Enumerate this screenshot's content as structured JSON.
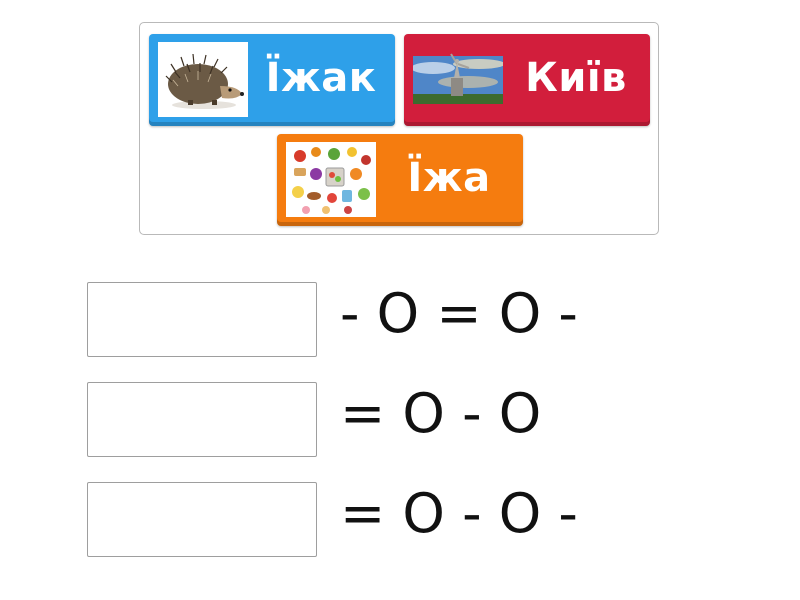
{
  "cards": [
    {
      "word": "Їжак",
      "image": "hedgehog-image",
      "color": "#2ea0e9"
    },
    {
      "word": "Київ",
      "image": "kyiv-motherland-monument-image",
      "color": "#d21e3c"
    },
    {
      "word": "Їжа",
      "image": "food-assortment-image",
      "color": "#f57c0f"
    }
  ],
  "rows": [
    {
      "pattern": "- O = O -"
    },
    {
      "pattern": "= O - O"
    },
    {
      "pattern": "= O - O -"
    }
  ]
}
